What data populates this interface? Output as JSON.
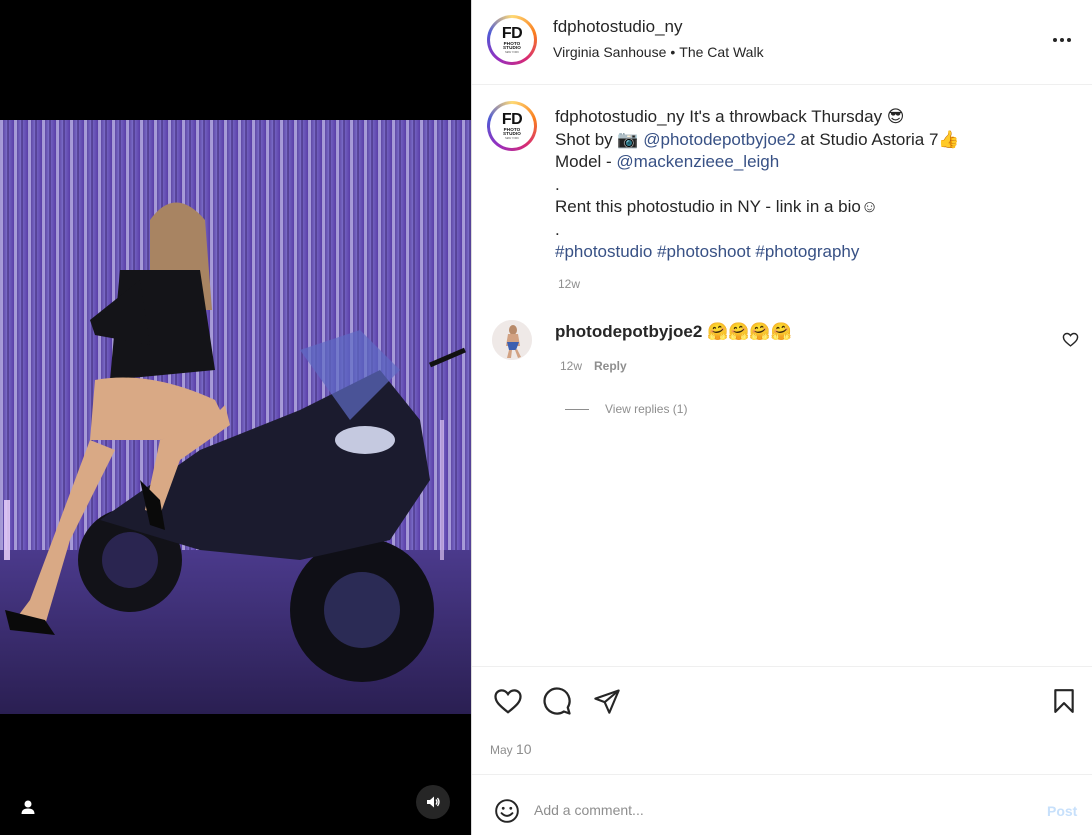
{
  "header": {
    "username": "fdphotostudio_ny",
    "location_person": "Virginia Sanhouse",
    "separator": "•",
    "location_place": "The Cat Walk",
    "more_icon": "more-horizontal-icon"
  },
  "logo": {
    "main": "FD",
    "line1": "PHOTO",
    "line2": "STUDIO",
    "line3": "NEW YORK"
  },
  "caption": {
    "username": "fdphotostudio_ny",
    "line1_text": "It's a throwback Thursday 😎",
    "line2_prefix": "Shot by 📷 ",
    "line2_link": "@photodepotbyjoe2",
    "line2_suffix": " at Studio Astoria 7👍",
    "line3_prefix": "Model - ",
    "line3_link": "@mackenzieee_leigh",
    "dot1": ".",
    "line4": "Rent this photostudio in NY - link in a bio☺",
    "dot2": ".",
    "hashtags": "#photostudio #photoshoot #photography",
    "time": "12w"
  },
  "comment": {
    "username": "photodepotbyjoe2",
    "text": "🤗🤗🤗🤗",
    "time": "12w",
    "reply_label": "Reply",
    "view_replies": "View replies (1)"
  },
  "actions": {
    "like_icon": "heart-icon",
    "comment_icon": "comment-icon",
    "share_icon": "send-icon",
    "save_icon": "bookmark-icon",
    "date_month": "May",
    "date_day": "10"
  },
  "comment_bar": {
    "emoji_icon": "emoji-icon",
    "placeholder": "Add a comment...",
    "post_label": "Post"
  },
  "colors": {
    "link": "#385185",
    "muted": "#8e8e8e",
    "post_disabled": "#c7e0fb"
  }
}
